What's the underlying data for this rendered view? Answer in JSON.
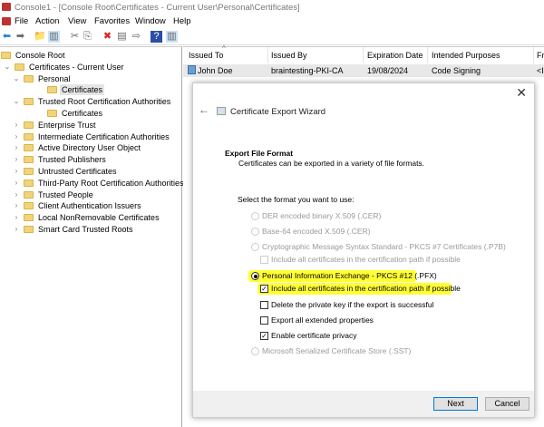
{
  "window": {
    "title": "Console1 - [Console Root\\Certificates - Current User\\Personal\\Certificates]"
  },
  "menu": [
    "File",
    "Action",
    "View",
    "Favorites",
    "Window",
    "Help"
  ],
  "toolbar": [
    {
      "icon": "back-icon",
      "glyph": "⬅"
    },
    {
      "icon": "forward-icon",
      "glyph": "➡"
    },
    {
      "icon": "up-folder-icon",
      "glyph": "📁"
    },
    {
      "icon": "show-hide-tree-icon",
      "glyph": "▥"
    },
    {
      "icon": "cut-icon",
      "glyph": "✂"
    },
    {
      "icon": "copy-icon",
      "glyph": "⎘"
    },
    {
      "icon": "delete-icon",
      "glyph": "✖"
    },
    {
      "icon": "properties-icon",
      "glyph": "▤"
    },
    {
      "icon": "export-list-icon",
      "glyph": "⇨"
    },
    {
      "icon": "help-icon",
      "glyph": "?"
    },
    {
      "icon": "action-pane-icon",
      "glyph": "▥"
    }
  ],
  "tree": [
    {
      "label": "Console Root",
      "level": 0,
      "chev": ""
    },
    {
      "label": "Certificates - Current User",
      "level": 0,
      "chev": "v"
    },
    {
      "label": "Personal",
      "level": 1,
      "chev": "v"
    },
    {
      "label": "Certificates",
      "level": 2,
      "chev": "",
      "selected": true
    },
    {
      "label": "Trusted Root Certification Authorities",
      "level": 1,
      "chev": "v"
    },
    {
      "label": "Certificates",
      "level": 2,
      "chev": ""
    },
    {
      "label": "Enterprise Trust",
      "level": 1,
      "chev": ">"
    },
    {
      "label": "Intermediate Certification Authorities",
      "level": 1,
      "chev": ">"
    },
    {
      "label": "Active Directory User Object",
      "level": 1,
      "chev": ">"
    },
    {
      "label": "Trusted Publishers",
      "level": 1,
      "chev": ">"
    },
    {
      "label": "Untrusted Certificates",
      "level": 1,
      "chev": ">"
    },
    {
      "label": "Third-Party Root Certification Authorities",
      "level": 1,
      "chev": ">"
    },
    {
      "label": "Trusted People",
      "level": 1,
      "chev": ">"
    },
    {
      "label": "Client Authentication Issuers",
      "level": 1,
      "chev": ">"
    },
    {
      "label": "Local NonRemovable Certificates",
      "level": 1,
      "chev": ">"
    },
    {
      "label": "Smart Card Trusted Roots",
      "level": 1,
      "chev": ">"
    }
  ],
  "list": {
    "columns": [
      "Issued To",
      "Issued By",
      "Expiration Date",
      "Intended Purposes",
      "Fr"
    ],
    "rows": [
      [
        "John Doe",
        "braintesting-PKI-CA",
        "19/08/2024",
        "Code Signing",
        "<I"
      ]
    ]
  },
  "dialog": {
    "title": "Certificate Export Wizard",
    "heading": "Export File Format",
    "subheading": "Certificates can be exported in a variety of file formats.",
    "prompt": "Select the format you want to use:",
    "options": [
      {
        "type": "radio",
        "label": "DER encoded binary X.509 (.CER)",
        "disabled": true,
        "checked": false
      },
      {
        "type": "radio",
        "label": "Base-64 encoded X.509 (.CER)",
        "disabled": true,
        "checked": false
      },
      {
        "type": "radio",
        "label": "Cryptographic Message Syntax Standard - PKCS #7 Certificates (.P7B)",
        "disabled": true,
        "checked": false
      },
      {
        "type": "checkbox",
        "label": "Include all certificates in the certification path if possible",
        "disabled": true,
        "checked": false
      },
      {
        "type": "radio",
        "label": "Personal Information Exchange - PKCS #12 (.PFX)",
        "disabled": false,
        "checked": true,
        "highlight": true
      },
      {
        "type": "checkbox",
        "label": "Include all certificates in the certification path if possible",
        "disabled": false,
        "checked": true,
        "highlight": true
      },
      {
        "type": "checkbox",
        "label": "Delete the private key if the export is successful",
        "disabled": false,
        "checked": false
      },
      {
        "type": "checkbox",
        "label": "Export all extended properties",
        "disabled": false,
        "checked": false
      },
      {
        "type": "checkbox",
        "label": "Enable certificate privacy",
        "disabled": false,
        "checked": true
      },
      {
        "type": "radio",
        "label": "Microsoft Serialized Certificate Store (.SST)",
        "disabled": true,
        "checked": false
      }
    ],
    "next": "Next",
    "cancel": "Cancel"
  },
  "colors": {
    "highlight": "#ffff33",
    "accent": "#0078d7"
  }
}
